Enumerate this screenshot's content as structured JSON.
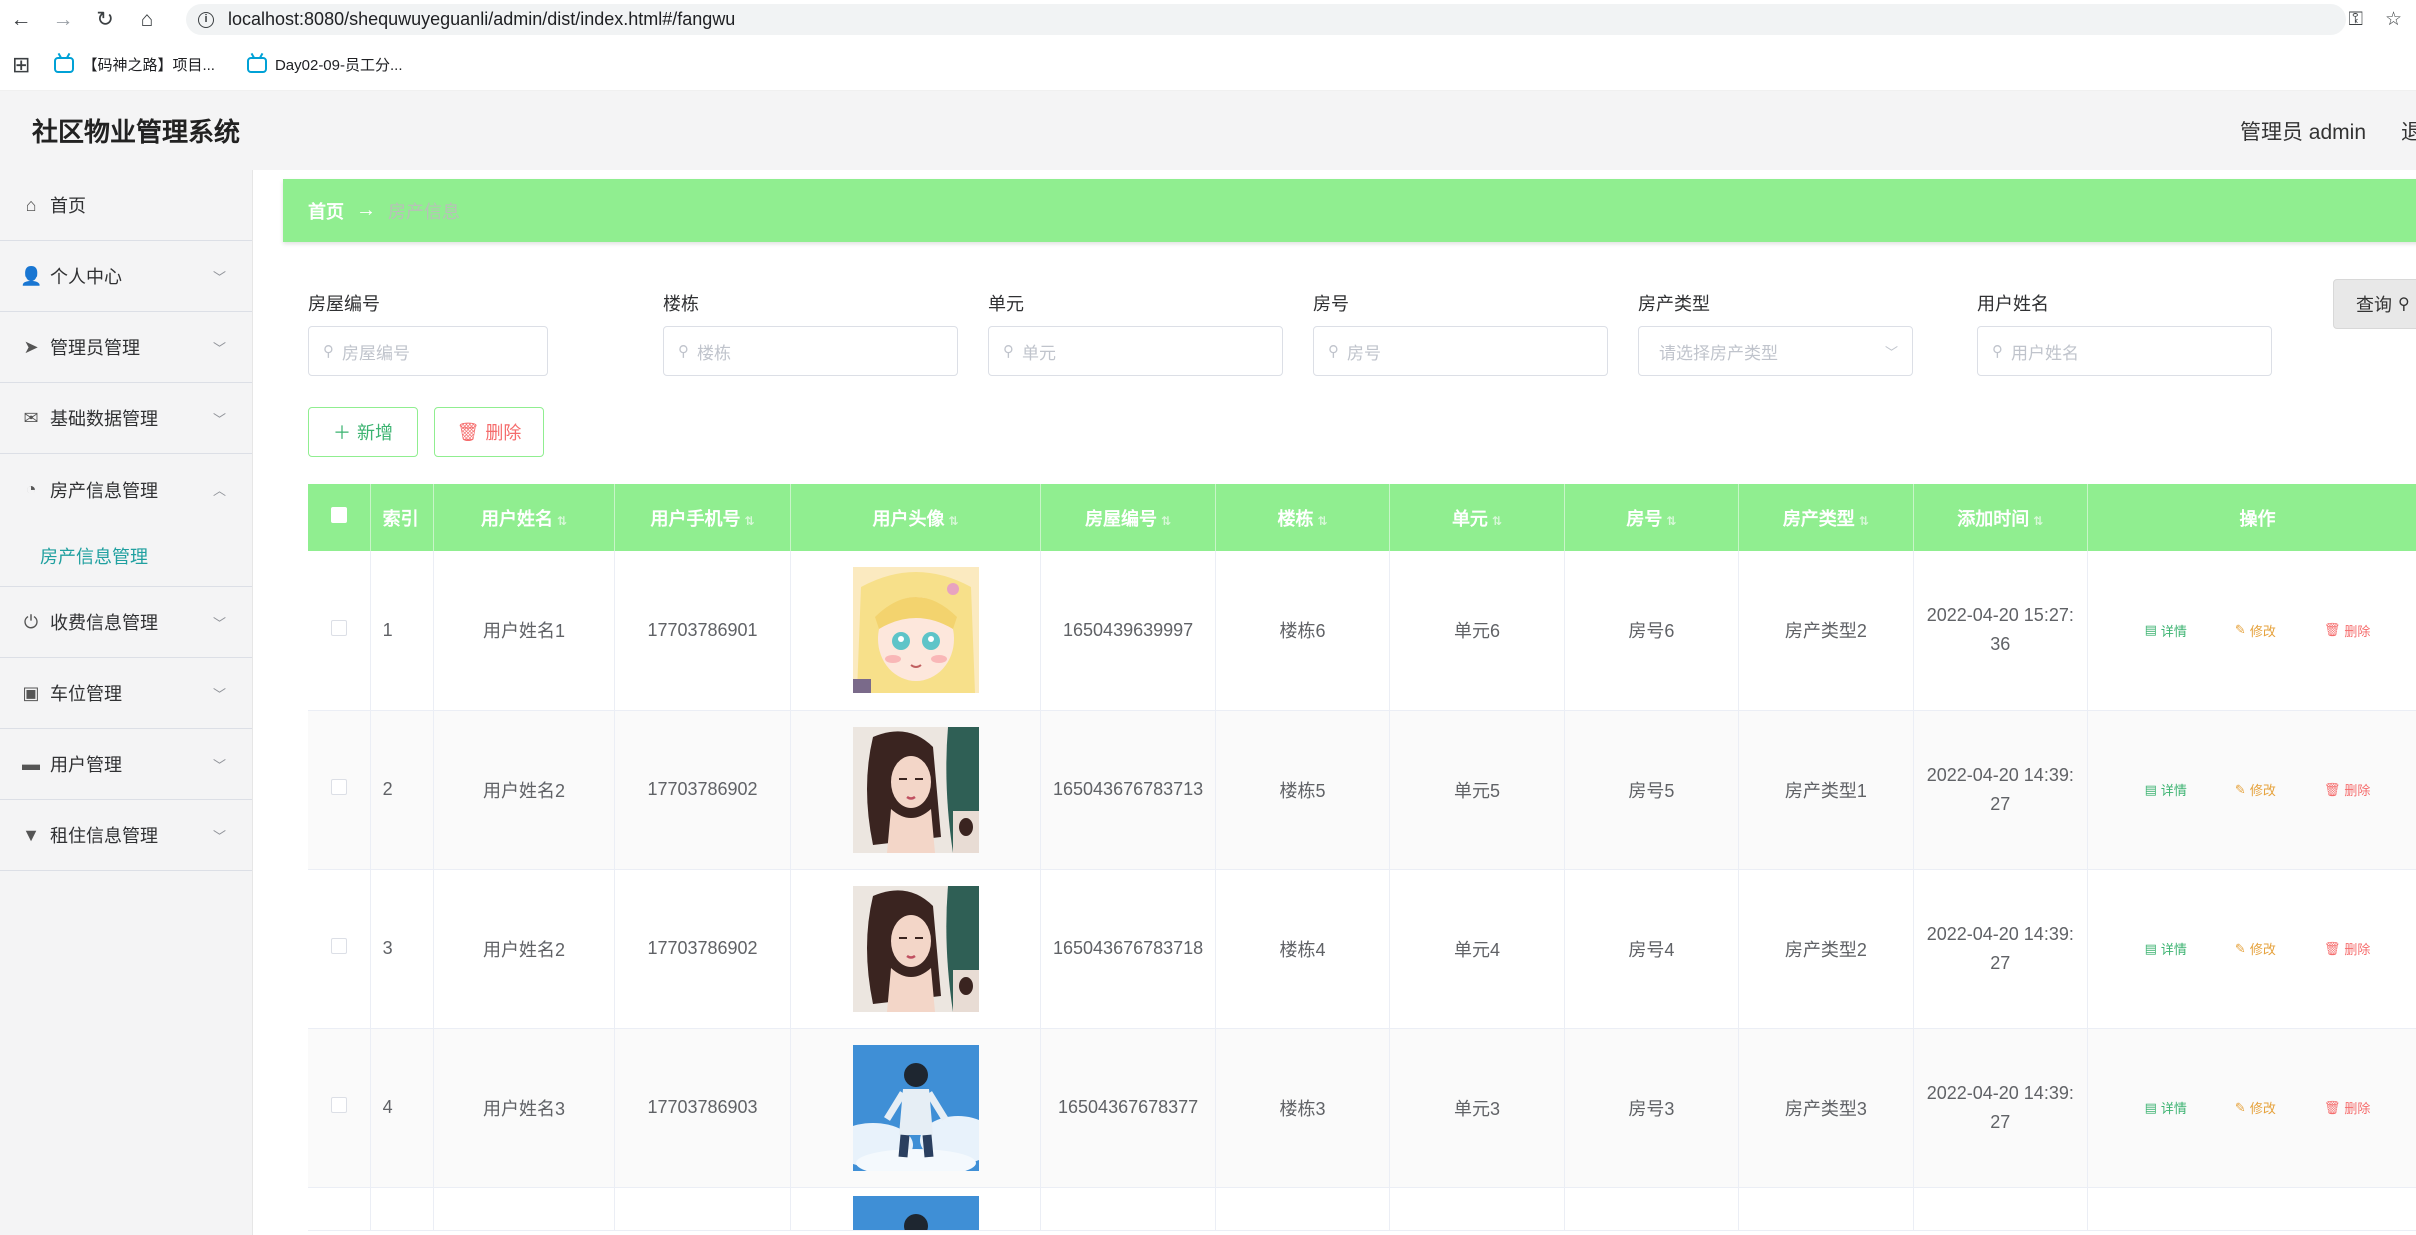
{
  "browser": {
    "url": "localhost:8080/shequwuyeguanli/admin/dist/index.html#/fangwu",
    "bookmarks": [
      {
        "label": "【码神之路】项目..."
      },
      {
        "label": "Day02-09-员工分..."
      }
    ]
  },
  "header": {
    "title": "社区物业管理系统",
    "admin": "管理员 admin",
    "logout": "退"
  },
  "sidebar": {
    "items": [
      {
        "label": "首页",
        "icon": "home-icon",
        "glyph": "⌂"
      },
      {
        "label": "个人中心",
        "icon": "user-icon",
        "glyph": "👤"
      },
      {
        "label": "管理员管理",
        "icon": "paper-plane-icon",
        "glyph": "➤"
      },
      {
        "label": "基础数据管理",
        "icon": "mail-icon",
        "glyph": "✉"
      },
      {
        "label": "房产信息管理",
        "icon": "compass-icon",
        "glyph": "◔"
      },
      {
        "label": "收费信息管理",
        "icon": "power-icon",
        "glyph": "⏻"
      },
      {
        "label": "车位管理",
        "icon": "clipboard-icon",
        "glyph": "▣"
      },
      {
        "label": "用户管理",
        "icon": "monitor-icon",
        "glyph": "▬"
      },
      {
        "label": "租住信息管理",
        "icon": "brush-icon",
        "glyph": "▼"
      }
    ],
    "sub_item": "房产信息管理"
  },
  "breadcrumb": {
    "home": "首页",
    "arrow": "→",
    "current": "房产信息"
  },
  "filters": {
    "house_no": {
      "label": "房屋编号",
      "placeholder": "房屋编号"
    },
    "building": {
      "label": "楼栋",
      "placeholder": "楼栋"
    },
    "unit": {
      "label": "单元",
      "placeholder": "单元"
    },
    "room": {
      "label": "房号",
      "placeholder": "房号"
    },
    "house_type": {
      "label": "房产类型",
      "placeholder": "请选择房产类型"
    },
    "user_name": {
      "label": "用户姓名",
      "placeholder": "用户姓名"
    },
    "query_button": "查询"
  },
  "actions": {
    "add": "新增",
    "delete": "删除"
  },
  "table": {
    "headers": [
      "索引",
      "用户姓名",
      "用户手机号",
      "用户头像",
      "房屋编号",
      "楼栋",
      "单元",
      "房号",
      "房产类型",
      "添加时间",
      "操作"
    ],
    "op_labels": {
      "detail": "详情",
      "edit": "修改",
      "delete": "删除"
    },
    "rows": [
      {
        "index": "1",
        "name": "用户姓名1",
        "phone": "17703786901",
        "house_no": "1650439639997",
        "building": "楼栋6",
        "unit": "单元6",
        "room": "房号6",
        "type": "房产类型2",
        "time": "2022-04-20 15:27:36"
      },
      {
        "index": "2",
        "name": "用户姓名2",
        "phone": "17703786902",
        "house_no": "165043676783713",
        "building": "楼栋5",
        "unit": "单元5",
        "room": "房号5",
        "type": "房产类型1",
        "time": "2022-04-20 14:39:27"
      },
      {
        "index": "3",
        "name": "用户姓名2",
        "phone": "17703786902",
        "house_no": "165043676783718",
        "building": "楼栋4",
        "unit": "单元4",
        "room": "房号4",
        "type": "房产类型2",
        "time": "2022-04-20 14:39:27"
      },
      {
        "index": "4",
        "name": "用户姓名3",
        "phone": "17703786903",
        "house_no": "16504367678377",
        "building": "楼栋3",
        "unit": "单元3",
        "room": "房号3",
        "type": "房产类型3",
        "time": "2022-04-20 14:39:27"
      }
    ]
  },
  "colors": {
    "accent_green": "#90ee90",
    "active_teal": "#20a0a0",
    "danger": "#f56c6c",
    "warning": "#e6a23c",
    "success": "#3cb371"
  }
}
